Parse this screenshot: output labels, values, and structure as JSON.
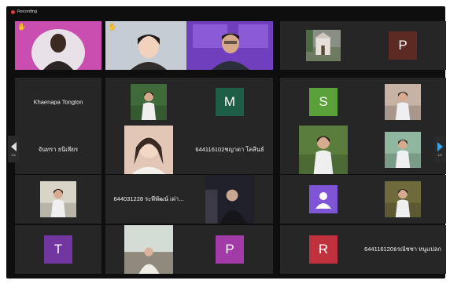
{
  "recording": {
    "label": "Recording",
    "color": "#e03a3a"
  },
  "navigation": {
    "prev_page": "1/4",
    "next_page": "1/4",
    "next_color": "#3aa0e8"
  },
  "tiles": [
    {
      "type": "video",
      "face": "dark",
      "bg": "#c94eb0",
      "hand": "✋",
      "raised": true
    },
    {
      "type": "video",
      "face": "light",
      "bg": "#b9c3cf",
      "hand": "✋",
      "raised": true
    },
    {
      "type": "video",
      "face": "presenter",
      "bg": "#7c47c9",
      "active": true
    },
    {
      "type": "photo",
      "bg": "#8a8f86",
      "scene": "building"
    },
    {
      "type": "avatar",
      "initial": "P",
      "color": "#5d2a23"
    },
    {
      "type": "name",
      "name": "Khaenapa Tongton"
    },
    {
      "type": "photo",
      "bg": "#3f6a3a",
      "scene": "person"
    },
    {
      "type": "avatar",
      "initial": "M",
      "color": "#1f5e46"
    },
    {
      "type": "avatar",
      "initial": "S",
      "color": "#5aa13a"
    },
    {
      "type": "photo",
      "bg": "#c6b3a5",
      "scene": "person"
    },
    {
      "type": "name",
      "name": "จันทรา ธนิเพียร"
    },
    {
      "type": "photo",
      "bg": "#d7b9a8",
      "scene": "selfie"
    },
    {
      "type": "name",
      "name": "644116102ชญาดา โคสินธ์"
    },
    {
      "type": "photo",
      "bg": "#5a7d3e",
      "scene": "person"
    },
    {
      "type": "photo",
      "bg": "#8fb7a0",
      "scene": "person"
    },
    {
      "type": "photo",
      "bg": "#d9d4c8",
      "scene": "person"
    },
    {
      "type": "name",
      "name": "644031228 ระพีพัฒน์ เผ่า..."
    },
    {
      "type": "photo",
      "bg": "#2a2a36",
      "scene": "night"
    },
    {
      "type": "icon-avatar",
      "color": "#7d55d6"
    },
    {
      "type": "photo",
      "bg": "#6e6a3c",
      "scene": "person"
    },
    {
      "type": "avatar",
      "initial": "T",
      "color": "#7236a0"
    },
    {
      "type": "photo",
      "bg": "#b4c0b6",
      "scene": "room"
    },
    {
      "type": "avatar",
      "initial": "P",
      "color": "#a23aa8"
    },
    {
      "type": "avatar",
      "initial": "R",
      "color": "#c0313d"
    },
    {
      "type": "name",
      "name": "644116120ธรณัชชา หนูแปลก"
    }
  ]
}
